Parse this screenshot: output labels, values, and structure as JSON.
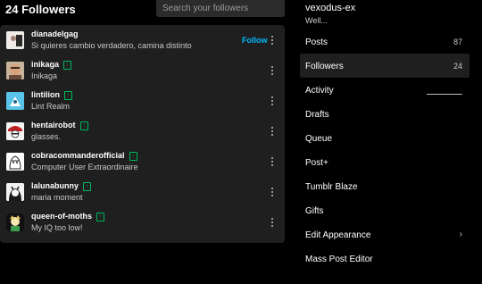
{
  "header": {
    "followers_title": "24 Followers",
    "search_placeholder": "Search your followers"
  },
  "followers": [
    {
      "username": "dianadelgag",
      "title": "Si quieres cambio verdadero, camina distinto",
      "follow_label": "Follow",
      "badge": false
    },
    {
      "username": "inikaga",
      "title": "Inikaga",
      "badge": true
    },
    {
      "username": "lintilion",
      "title": "Lint Realm",
      "badge": true
    },
    {
      "username": "hentairobot",
      "title": "glasses.",
      "badge": true
    },
    {
      "username": "cobracommanderofficial",
      "title": "Computer User Extraordinaire",
      "badge": true
    },
    {
      "username": "lalunabunny",
      "title": "maria moment",
      "badge": true
    },
    {
      "username": "queen-of-moths",
      "title": "My IQ too low!",
      "badge": true
    }
  ],
  "sidebar": {
    "blog_name": "vexodus-ex",
    "blog_title": "Well...",
    "items": [
      {
        "label": "Posts",
        "count": "87"
      },
      {
        "label": "Followers",
        "count": "24"
      },
      {
        "label": "Activity"
      },
      {
        "label": "Drafts"
      },
      {
        "label": "Queue"
      },
      {
        "label": "Post+"
      },
      {
        "label": "Tumblr Blaze"
      },
      {
        "label": "Gifts"
      },
      {
        "label": "Edit Appearance",
        "chevron": "›"
      },
      {
        "label": "Mass Post Editor"
      }
    ]
  },
  "colors": {
    "background": "#000000",
    "panel": "#1f1f1f",
    "follow_accent": "#00b8ff",
    "badge_green": "#00b85c"
  }
}
